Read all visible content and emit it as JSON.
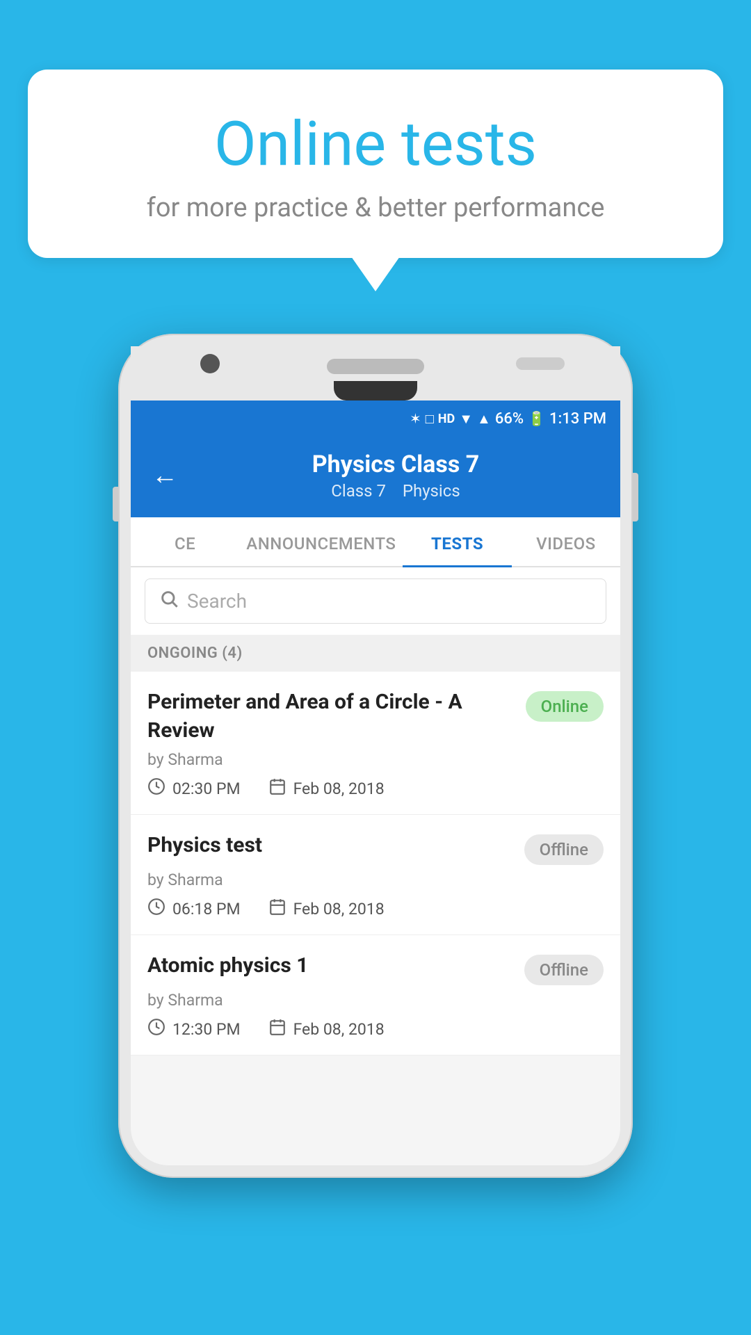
{
  "background_color": "#29b6e8",
  "bubble": {
    "title": "Online tests",
    "subtitle": "for more practice & better performance"
  },
  "phone": {
    "status_bar": {
      "battery": "66%",
      "time": "1:13 PM"
    },
    "app_bar": {
      "title": "Physics Class 7",
      "subtitle_class": "Class 7",
      "subtitle_subject": "Physics",
      "back_label": "←"
    },
    "tabs": [
      {
        "label": "CE",
        "active": false
      },
      {
        "label": "ANNOUNCEMENTS",
        "active": false
      },
      {
        "label": "TESTS",
        "active": true
      },
      {
        "label": "VIDEOS",
        "active": false
      }
    ],
    "search": {
      "placeholder": "Search"
    },
    "section": {
      "label": "ONGOING (4)"
    },
    "tests": [
      {
        "title": "Perimeter and Area of a Circle - A Review",
        "author": "by Sharma",
        "time": "02:30 PM",
        "date": "Feb 08, 2018",
        "status": "Online",
        "status_type": "online"
      },
      {
        "title": "Physics test",
        "author": "by Sharma",
        "time": "06:18 PM",
        "date": "Feb 08, 2018",
        "status": "Offline",
        "status_type": "offline"
      },
      {
        "title": "Atomic physics 1",
        "author": "by Sharma",
        "time": "12:30 PM",
        "date": "Feb 08, 2018",
        "status": "Offline",
        "status_type": "offline"
      }
    ]
  }
}
